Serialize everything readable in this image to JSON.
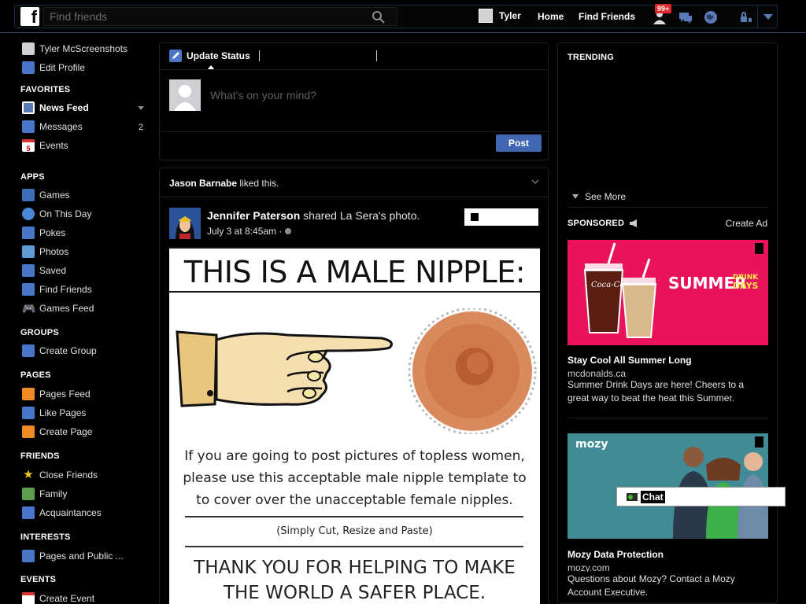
{
  "topbar": {
    "logo": "f",
    "search_placeholder": "Find friends",
    "user_name": "Tyler",
    "home": "Home",
    "find_friends": "Find Friends",
    "friend_requests_badge": "99+"
  },
  "leftnav": {
    "profile_name": "Tyler McScreenshots",
    "edit_profile": "Edit Profile",
    "favorites_heading": "FAVORITES",
    "favorites": [
      {
        "label": "News Feed",
        "icon": "news-feed-icon"
      },
      {
        "label": "Messages",
        "icon": "messages-icon",
        "count": "2"
      },
      {
        "label": "Events",
        "icon": "events-icon",
        "icon_text": "5"
      }
    ],
    "apps_heading": "APPS",
    "apps": [
      {
        "label": "Games",
        "icon": "games-icon"
      },
      {
        "label": "On This Day",
        "icon": "on-this-day-icon"
      },
      {
        "label": "Pokes",
        "icon": "pokes-icon"
      },
      {
        "label": "Photos",
        "icon": "photos-icon"
      },
      {
        "label": "Saved",
        "icon": "saved-icon"
      },
      {
        "label": "Find Friends",
        "icon": "find-friends-icon"
      },
      {
        "label": "Games Feed",
        "icon": "games-feed-icon"
      }
    ],
    "groups_heading": "GROUPS",
    "groups": [
      {
        "label": "Create Group",
        "icon": "create-group-icon"
      }
    ],
    "pages_heading": "PAGES",
    "pages": [
      {
        "label": "Pages Feed",
        "icon": "pages-feed-icon"
      },
      {
        "label": "Like Pages",
        "icon": "like-pages-icon"
      },
      {
        "label": "Create Page",
        "icon": "create-page-icon"
      }
    ],
    "friends_heading": "FRIENDS",
    "friends": [
      {
        "label": "Close Friends",
        "icon": "close-friends-icon"
      },
      {
        "label": "Family",
        "icon": "family-icon"
      },
      {
        "label": "Acquaintances",
        "icon": "acquaintances-icon"
      }
    ],
    "interests_heading": "INTERESTS",
    "interests": [
      {
        "label": "Pages and Public ...",
        "icon": "pages-public-icon"
      }
    ],
    "events_heading": "EVENTS",
    "events": [
      {
        "label": "Create Event",
        "icon": "create-event-icon"
      }
    ]
  },
  "composer": {
    "tab_label": "Update Status",
    "placeholder": "What's on your mind?",
    "post_button": "Post"
  },
  "story": {
    "liked_by": "Jason Barnabe",
    "liked_suffix": " liked this.",
    "author": "Jennifer Paterson",
    "action": " shared La Sera's photo.",
    "date": "July 3 at 8:45am · ",
    "meme": {
      "title": "THIS IS A MALE NIPPLE:",
      "body_lines": [
        "If you are going to post pictures of topless women,",
        "please use this acceptable male nipple template to",
        "to cover over the unacceptable female nipples."
      ],
      "small": "(Simply Cut, Resize and Paste)",
      "foot_lines": [
        "THANK YOU FOR HELPING TO MAKE",
        "THE WORLD A SAFER PLACE."
      ]
    }
  },
  "right": {
    "trending_heading": "TRENDING",
    "see_more": "See More",
    "sponsored_heading": "SPONSORED",
    "create_ad": "Create Ad",
    "ads": [
      {
        "title": "Stay Cool All Summer Long",
        "domain": "mcdonalds.ca",
        "text": "Summer Drink Days are here! Cheers to a great way to beat the heat this Summer.",
        "image_text_1": "SUMMER",
        "image_text_2": "DRINK",
        "image_text_3": "DAYS",
        "image_brand": "Coca-Cola",
        "color": "#e8125d"
      },
      {
        "title": "Mozy Data Protection",
        "domain": "mozy.com",
        "text": "Questions about Mozy? Contact a Mozy Account Executive.",
        "image_brand": "mozy",
        "color": "#3f8a96"
      }
    ],
    "chat_label": "Chat"
  },
  "colors": {
    "brand_blue": "#4267b2",
    "badge_red": "#e3282b"
  }
}
